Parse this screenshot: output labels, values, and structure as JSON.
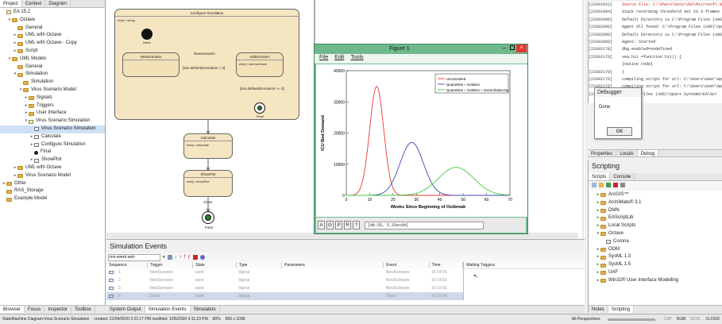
{
  "browser": {
    "tabs": [
      "Project",
      "Context",
      "Diagram"
    ],
    "bottom_tabs": [
      "Browser",
      "Focus",
      "Inspector",
      "Toolbox"
    ],
    "tree": [
      {
        "label": "EA 15.2",
        "indent": 0,
        "icon": "model",
        "exp": ""
      },
      {
        "label": "Octave",
        "indent": 1,
        "icon": "folder",
        "exp": "▾"
      },
      {
        "label": "General",
        "indent": 2,
        "icon": "folder",
        "exp": ""
      },
      {
        "label": "UML with Octave",
        "indent": 2,
        "icon": "folder",
        "exp": "▸"
      },
      {
        "label": "UML with Octave - Copy",
        "indent": 2,
        "icon": "folder",
        "exp": "▸"
      },
      {
        "label": "Script",
        "indent": 2,
        "icon": "folder",
        "exp": "▸"
      },
      {
        "label": "UML Models",
        "indent": 1,
        "icon": "folder",
        "exp": "▾"
      },
      {
        "label": "General",
        "indent": 2,
        "icon": "folder",
        "exp": ""
      },
      {
        "label": "Simulation",
        "indent": 2,
        "icon": "folder",
        "exp": "▾"
      },
      {
        "label": "Simulation",
        "indent": 3,
        "icon": "folder",
        "exp": ""
      },
      {
        "label": "Virus Scenario Model",
        "indent": 3,
        "icon": "folder",
        "exp": "▾"
      },
      {
        "label": "Signals",
        "indent": 4,
        "icon": "folder",
        "exp": "▸"
      },
      {
        "label": "Triggers",
        "indent": 4,
        "icon": "folder",
        "exp": "▸"
      },
      {
        "label": "User Interface",
        "indent": 4,
        "icon": "folder",
        "exp": "▸"
      },
      {
        "label": "Virus Scenario Simulation",
        "indent": 4,
        "icon": "package",
        "exp": "▾"
      },
      {
        "label": "Virus Scenario Simulation",
        "indent": 5,
        "icon": "diagram",
        "exp": ""
      },
      {
        "label": "Calculate",
        "indent": 5,
        "icon": "state",
        "exp": "▸"
      },
      {
        "label": "Configure Simulation",
        "indent": 5,
        "icon": "state",
        "exp": "▸"
      },
      {
        "label": "Final",
        "indent": 5,
        "icon": "final",
        "exp": ""
      },
      {
        "label": "ShowPlot",
        "indent": 5,
        "icon": "state",
        "exp": "▸"
      },
      {
        "label": "UML with Octave",
        "indent": 2,
        "icon": "folder",
        "exp": "▸"
      },
      {
        "label": "Virus Scenario Model",
        "indent": 2,
        "icon": "folder",
        "exp": "▸"
      },
      {
        "label": "Other",
        "indent": 0,
        "icon": "folder",
        "exp": "▸"
      },
      {
        "label": "RAS_Storage",
        "indent": 0,
        "icon": "folder",
        "exp": ""
      },
      {
        "label": "Example Model",
        "indent": 0,
        "icon": "folder",
        "exp": ""
      }
    ]
  },
  "diagram": {
    "composite": {
      "title": "Configure Simulation",
      "entry": "entry / setup"
    },
    "initial_label": "Initial",
    "new_scenario": {
      "title": "NewScenario"
    },
    "add_scenario": {
      "title": "AddScenario",
      "entry": "entry / add scenario"
    },
    "transition_new": "NewScenario",
    "guard1": "[sim.definedScenarios < 3]",
    "guard2": "[sim.definedScenarios >= 3]",
    "inner_final_label": "Final",
    "calculate": {
      "title": "Calculate",
      "entry": "entry / calculate"
    },
    "showplot": {
      "title": "ShowPlot",
      "entry": "entry / showPlot"
    },
    "close_label": "Close",
    "final_label": "Final"
  },
  "figure": {
    "title": "Figure 1",
    "menu": [
      "File",
      "Edit",
      "Tools"
    ],
    "status_buttons": [
      "A",
      "G",
      "P",
      "R",
      "?"
    ],
    "coords": "[40.55, 5.25e+04]"
  },
  "chart_data": {
    "type": "line",
    "title": "",
    "xlabel": "Weeks Since Beginning of Outbreak",
    "ylabel": "ICU Bed Demand",
    "xlim": [
      0,
      70
    ],
    "ylim": [
      0,
      40000
    ],
    "xticks": [
      0,
      10,
      20,
      30,
      40,
      50,
      60,
      70
    ],
    "yticks": [
      0,
      10000,
      20000,
      30000,
      40000
    ],
    "grid": false,
    "legend_position": "top-right",
    "series": [
      {
        "name": "Uncontrolled",
        "color": "#e53935",
        "peak_x": 13,
        "peak_y": 35000,
        "sigma": 3.0
      },
      {
        "name": "Quarantine + isolation",
        "color": "#3949ab",
        "peak_x": 28,
        "peak_y": 17000,
        "sigma": 5.0
      },
      {
        "name": "Quarantine + isolation + social distancing",
        "color": "#43c843",
        "peak_x": 47,
        "peak_y": 9000,
        "sigma": 7.5
      }
    ]
  },
  "events": {
    "title": "Simulation Events",
    "event_set_placeholder": "<no event set>",
    "columns": [
      "Sequence",
      "Trigger",
      "State",
      "Type",
      "Parameters",
      "Event",
      "Time"
    ],
    "rows": [
      {
        "seq": "1",
        "trigger": "NewScenario",
        "state": "used",
        "type": "Signal",
        "event": "NewScenario",
        "time": "16:14:55"
      },
      {
        "seq": "2",
        "trigger": "NewScenario",
        "state": "used",
        "type": "Signal",
        "event": "NewScenario",
        "time": "16:14:59"
      },
      {
        "seq": "3",
        "trigger": "NewScenario",
        "state": "used",
        "type": "Signal",
        "event": "NewScenario",
        "time": "16:15:02"
      },
      {
        "seq": "4",
        "trigger": "Close",
        "state": "used",
        "type": "Signal",
        "event": "Close",
        "time": "16:15:04"
      }
    ],
    "waiting_title": "Waiting Triggers",
    "bottom_tabs": [
      "System Output",
      "Simulation Events",
      "Simulation"
    ]
  },
  "console": {
    "lines": [
      {
        "t": "[23301922]",
        "m": "Source File: C:\\Share\\Data\\VEA\\Microsoft.Native\\Co",
        "err": true
      },
      {
        "t": "[23301984]",
        "m": "Stack recording threshold set to 3 frames",
        "err": false
      },
      {
        "t": "[23302080]",
        "m": "Default Directory is C:\\Program Files (x86)\\Sparx Sy",
        "err": false
      },
      {
        "t": "[23302080]",
        "m": "Agent dll found: C:\\Program Files (x86)\\Sparx Syste",
        "err": false
      },
      {
        "t": "[23302080]",
        "m": "Default Directory is C:\\Program Files (x86)\\Sparx Sy",
        "err": false
      },
      {
        "t": "[23302080]",
        "m": "Agent: Started",
        "err": false
      },
      {
        "t": "[23302178]",
        "m": "dbg.enabled=undefined",
        "err": false
      },
      {
        "t": "[23302178]",
        "m": "vea.hit =function hit() {",
        "err": false
      },
      {
        "t": "",
        "m": "    [native code]",
        "err": false
      },
      {
        "t": "[23302178]",
        "m": "}",
        "err": false
      },
      {
        "t": "[23302178]",
        "m": "compiling script for url: C:\\Users\\User\\AppData\\Loca",
        "err": false
      },
      {
        "t": "[23302178]",
        "m": "compiling script for url: C:\\Users\\User\\AppData\\Loca",
        "err": false
      },
      {
        "t": "[23302178]",
        "m": "Program Files (x86)\\Sparx Systems\\EA\\Scr",
        "err": false
      }
    ]
  },
  "debugger": {
    "title": "Debugger",
    "message": "Done",
    "ok": "OK"
  },
  "props_tabs": [
    "Properties",
    "Locals",
    "Debug"
  ],
  "scripting": {
    "title": "Scripting",
    "tabs": [
      "Scripts",
      "Console"
    ],
    "tree": [
      {
        "label": "ArcGIS™",
        "indent": 1,
        "exp": "▸",
        "icon": "folder"
      },
      {
        "label": "ArchiMate® 3.1",
        "indent": 1,
        "exp": "▸",
        "icon": "folder"
      },
      {
        "label": "DMN",
        "indent": 1,
        "exp": "▸",
        "icon": "folder"
      },
      {
        "label": "EAScriptLib",
        "indent": 1,
        "exp": "▸",
        "icon": "folder"
      },
      {
        "label": "Local Scripts",
        "indent": 1,
        "exp": "▸",
        "icon": "folder"
      },
      {
        "label": "Octave",
        "indent": 1,
        "exp": "▾",
        "icon": "folder"
      },
      {
        "label": "Corona",
        "indent": 2,
        "exp": "",
        "icon": "script"
      },
      {
        "label": "ODM",
        "indent": 1,
        "exp": "▸",
        "icon": "folder"
      },
      {
        "label": "SysML 1.3",
        "indent": 1,
        "exp": "▸",
        "icon": "folder"
      },
      {
        "label": "SysML 1.5",
        "indent": 1,
        "exp": "▸",
        "icon": "folder"
      },
      {
        "label": "UAF",
        "indent": 1,
        "exp": "▸",
        "icon": "folder"
      },
      {
        "label": "Win32® User Interface Modelling",
        "indent": 1,
        "exp": "▸",
        "icon": "folder"
      }
    ],
    "bottom_tabs": [
      "Notes",
      "Scripting"
    ]
  },
  "statusbar": {
    "left": "StateMachine Diagram:Virus Scenario Simulation",
    "created": "created: 21/04/2020 2:21:17 PM  modified: 1/05/2020 4:11:23 PM",
    "zoom": "80%",
    "size": "850 x 1098",
    "perspective": "All Perspectives",
    "cap": "CAP",
    "num": "NUM",
    "scrl": "SCRL",
    "cloud": "CLOUD"
  },
  "colors": {
    "accent": "#2f6db5",
    "state_fill": "#f5e5c1",
    "figure_frame": "#6fb88e",
    "error_text": "#c62828"
  }
}
